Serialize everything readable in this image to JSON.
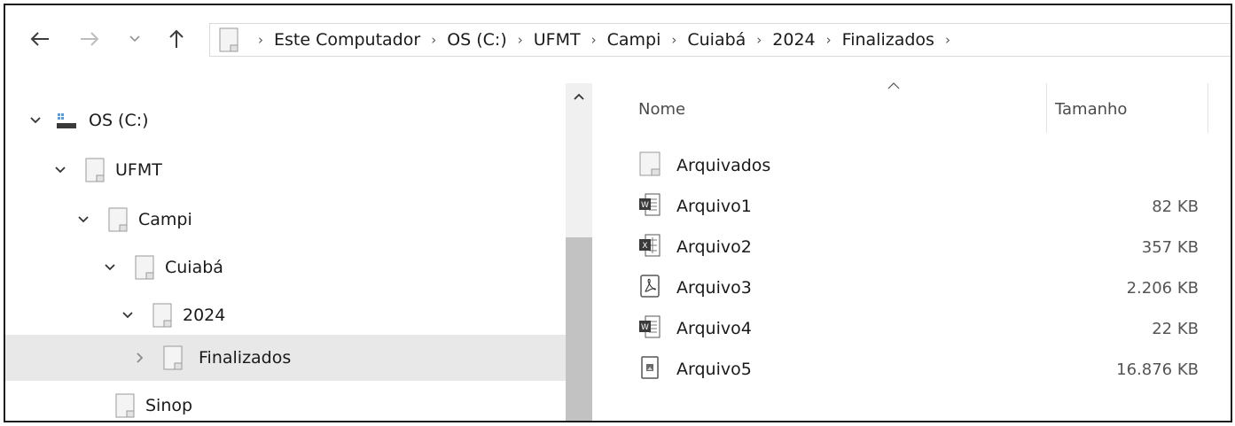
{
  "breadcrumb": [
    "Este Computador",
    "OS (C:)",
    "UFMT",
    "Campi",
    "Cuiabá",
    "2024",
    "Finalizados"
  ],
  "tree": [
    {
      "label": "OS (C:)",
      "expanded": true,
      "icon": "drive-icon"
    },
    {
      "label": "UFMT",
      "expanded": true,
      "icon": "folder-icon"
    },
    {
      "label": "Campi",
      "expanded": true,
      "icon": "folder-icon"
    },
    {
      "label": "Cuiabá",
      "expanded": true,
      "icon": "folder-icon"
    },
    {
      "label": "2024",
      "expanded": true,
      "icon": "folder-icon"
    },
    {
      "label": "Finalizados",
      "expanded": false,
      "selected": true,
      "icon": "folder-icon"
    },
    {
      "label": "Sinop",
      "icon": "folder-icon"
    }
  ],
  "columns": {
    "name": "Nome",
    "size": "Tamanho"
  },
  "files": [
    {
      "name": "Arquivados",
      "size": "",
      "icon": "folder-icon"
    },
    {
      "name": "Arquivo1",
      "size": "82 KB",
      "icon": "word-doc-icon"
    },
    {
      "name": "Arquivo2",
      "size": "357 KB",
      "icon": "excel-doc-icon"
    },
    {
      "name": "Arquivo3",
      "size": "2.206 KB",
      "icon": "pdf-doc-icon"
    },
    {
      "name": "Arquivo4",
      "size": "22 KB",
      "icon": "word-doc-icon"
    },
    {
      "name": "Arquivo5",
      "size": "16.876 KB",
      "icon": "image-file-icon"
    }
  ],
  "colors": {
    "selected_row": "#e8e8e8",
    "scroll_thumb": "#c2c2c2",
    "border": "#1c1c1c"
  }
}
